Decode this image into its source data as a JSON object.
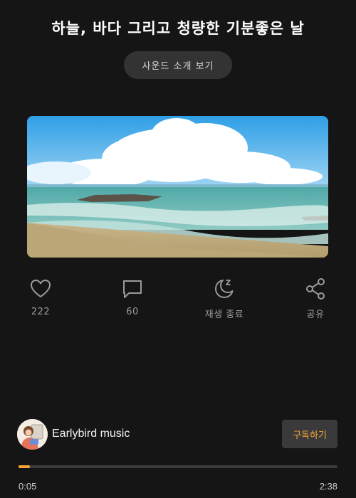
{
  "header": {
    "title": "하늘, 바다 그리고 청량한 기분좋은 날"
  },
  "sound_intro_button": {
    "label": "사운드 소개 보기"
  },
  "actions": [
    {
      "icon": "heart-icon",
      "label": "222"
    },
    {
      "icon": "comment-icon",
      "label": "60"
    },
    {
      "icon": "sleep-moon-icon",
      "label": "재생 종료"
    },
    {
      "icon": "share-icon",
      "label": "공유"
    }
  ],
  "author": {
    "name": "Earlybird music"
  },
  "subscribe_button": {
    "label": "구독하기"
  },
  "player": {
    "current_time": "0:05",
    "total_time": "2:38",
    "progress": 0.035
  },
  "colors": {
    "accent": "#f5a43a",
    "background": "#151515"
  }
}
